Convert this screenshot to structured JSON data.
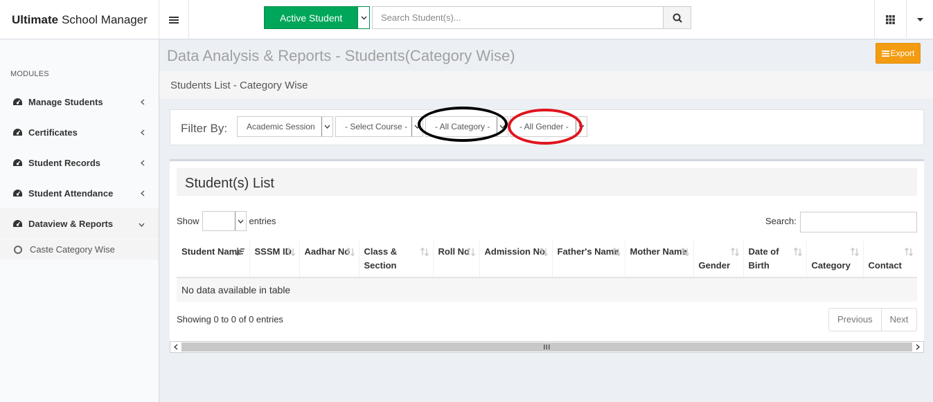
{
  "app": {
    "brand_bold": "Ultimate",
    "brand_rest": "School Manager"
  },
  "header": {
    "active_button": "Active Student",
    "search_placeholder": "Search Student(s)..."
  },
  "sidebar": {
    "section": "MODULES",
    "items": [
      {
        "label": "Manage Students"
      },
      {
        "label": "Certificates"
      },
      {
        "label": "Student Records"
      },
      {
        "label": "Student Attendance"
      },
      {
        "label": "Dataview & Reports"
      }
    ],
    "sub_item": "Caste Category Wise"
  },
  "page": {
    "title": "Data Analysis & Reports - Students(Category Wise)",
    "export_label": "Export",
    "subtitle": "Students List - Category Wise"
  },
  "filters": {
    "label": "Filter By:",
    "session": "Academic Session",
    "course": "- Select Course -",
    "category": "- All Category -",
    "gender": "- All Gender -"
  },
  "list": {
    "title": "Student(s) List",
    "show_label": "Show",
    "entries_label": "entries",
    "search_label": "Search:",
    "columns": [
      "Student Name",
      "SSSM ID",
      "Aadhar No",
      "Class & Section",
      "Roll No",
      "Admission No",
      "Father's Name",
      "Mother Name",
      "Gender",
      "Date of Birth",
      "Category",
      "Contact"
    ],
    "empty_message": "No data available in table",
    "info": "Showing 0 to 0 of 0 entries",
    "prev_label": "Previous",
    "next_label": "Next"
  },
  "colors": {
    "active_green": "#00a65a",
    "export_orange": "#f39c12",
    "annotation_black": "#000000",
    "annotation_red": "#e0141e"
  }
}
